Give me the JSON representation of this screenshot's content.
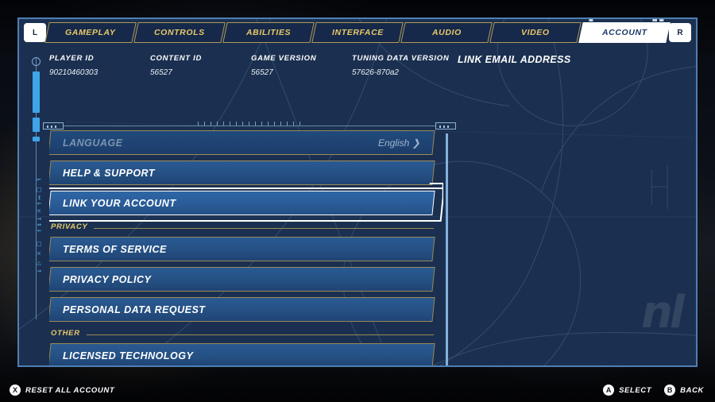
{
  "tabbar": {
    "left_shoulder": "L",
    "right_shoulder": "R",
    "tabs": [
      {
        "label": "GAMEPLAY",
        "active": false
      },
      {
        "label": "CONTROLS",
        "active": false
      },
      {
        "label": "ABILITIES",
        "active": false
      },
      {
        "label": "INTERFACE",
        "active": false
      },
      {
        "label": "AUDIO",
        "active": false
      },
      {
        "label": "VIDEO",
        "active": false
      },
      {
        "label": "ACCOUNT",
        "active": true
      }
    ]
  },
  "info": [
    {
      "label": "PLAYER ID",
      "value": "90210460303"
    },
    {
      "label": "CONTENT ID",
      "value": "56527"
    },
    {
      "label": "GAME VERSION",
      "value": "56527"
    },
    {
      "label": "TUNING DATA VERSION",
      "value": "57626-870a2"
    }
  ],
  "right_pane": {
    "title": "LINK EMAIL ADDRESS"
  },
  "list": {
    "entries": [
      {
        "type": "row",
        "label": "LANGUAGE",
        "value": "English ❯",
        "state": "disabled"
      },
      {
        "type": "row",
        "label": "HELP & SUPPORT",
        "value": "",
        "state": "normal"
      },
      {
        "type": "row",
        "label": "LINK YOUR ACCOUNT",
        "value": "",
        "state": "selected"
      },
      {
        "type": "section",
        "label": "PRIVACY"
      },
      {
        "type": "row",
        "label": "TERMS OF SERVICE",
        "value": "",
        "state": "normal"
      },
      {
        "type": "row",
        "label": "PRIVACY POLICY",
        "value": "",
        "state": "normal"
      },
      {
        "type": "row",
        "label": "PERSONAL DATA REQUEST",
        "value": "",
        "state": "normal"
      },
      {
        "type": "section",
        "label": "OTHER"
      },
      {
        "type": "row",
        "label": "LICENSED TECHNOLOGY",
        "value": "",
        "state": "normal"
      }
    ]
  },
  "left_strip": {
    "glyphs": "⌐□↤↓✕↑↕↓  □✕△↑"
  },
  "watermark": "nl",
  "bottom_bar": {
    "left": [
      {
        "button": "X",
        "label": "RESET ALL ACCOUNT"
      }
    ],
    "right": [
      {
        "button": "A",
        "label": "SELECT"
      },
      {
        "button": "B",
        "label": "BACK"
      }
    ]
  },
  "colors": {
    "panel_bg": "#1b3050",
    "panel_border": "#4e7fb4",
    "accent_gold": "#e8c96a",
    "row_border": "#9a8a56",
    "row_fill": "#255083",
    "selected_border": "#ffffff",
    "scrollbar": "#8fc0ea",
    "strip_cyan": "#3fa4e8"
  }
}
